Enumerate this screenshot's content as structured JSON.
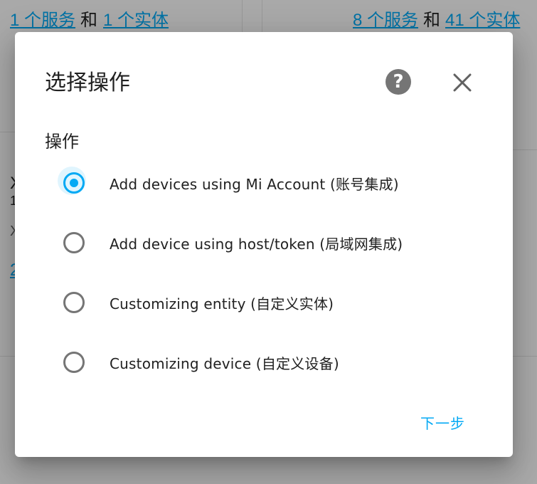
{
  "background": {
    "top_left": {
      "link1": "1 个服务",
      "and": "和",
      "link2": "1 个实体"
    },
    "top_right": {
      "link1": "8 个服务",
      "and": "和",
      "link2": "41 个实体"
    },
    "left_fragments": [
      "X",
      "1",
      "X",
      "2"
    ]
  },
  "dialog": {
    "title": "选择操作",
    "help_glyph": "?",
    "section_label": "操作",
    "options": [
      {
        "label": "Add devices using Mi Account (账号集成)",
        "checked": true
      },
      {
        "label": "Add device using host/token (局域网集成)",
        "checked": false
      },
      {
        "label": "Customizing entity (自定义实体)",
        "checked": false
      },
      {
        "label": "Customizing device (自定义设备)",
        "checked": false
      }
    ],
    "next_label": "下一步"
  },
  "colors": {
    "accent": "#03a9f4",
    "radio_unchecked": "#757575",
    "help_icon": "#757575"
  }
}
